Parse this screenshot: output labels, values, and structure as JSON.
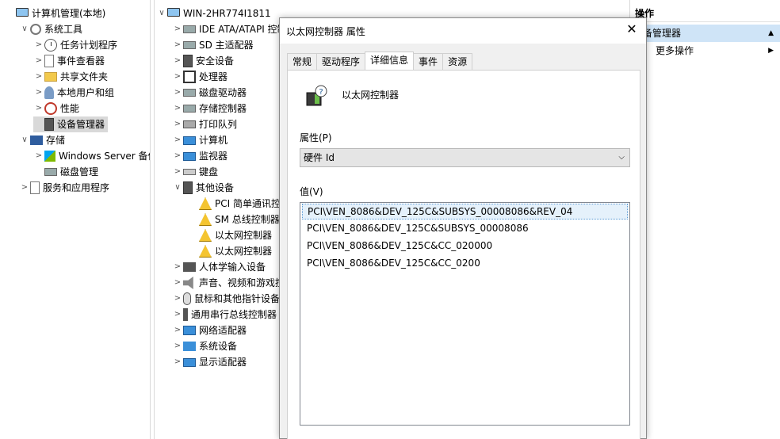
{
  "left_tree": {
    "items": [
      {
        "label": "计算机管理(本地)",
        "chev": "",
        "icon": "computer-management-icon",
        "indent": 0
      },
      {
        "label": "系统工具",
        "chev": "∨",
        "icon": "system-tools-icon",
        "indent": 1
      },
      {
        "label": "任务计划程序",
        "chev": ">",
        "icon": "task-scheduler-icon",
        "indent": 2
      },
      {
        "label": "事件查看器",
        "chev": ">",
        "icon": "event-viewer-icon",
        "indent": 2
      },
      {
        "label": "共享文件夹",
        "chev": ">",
        "icon": "shared-folders-icon",
        "indent": 2
      },
      {
        "label": "本地用户和组",
        "chev": ">",
        "icon": "local-users-icon",
        "indent": 2
      },
      {
        "label": "性能",
        "chev": ">",
        "icon": "performance-icon",
        "indent": 2
      },
      {
        "label": "设备管理器",
        "chev": "",
        "icon": "device-manager-icon",
        "indent": 2,
        "selected": true
      },
      {
        "label": "存储",
        "chev": "∨",
        "icon": "storage-icon",
        "indent": 1
      },
      {
        "label": "Windows Server 备份",
        "chev": ">",
        "icon": "windows-backup-icon",
        "indent": 2
      },
      {
        "label": "磁盘管理",
        "chev": "",
        "icon": "disk-management-icon",
        "indent": 2
      },
      {
        "label": "服务和应用程序",
        "chev": ">",
        "icon": "services-apps-icon",
        "indent": 1
      }
    ]
  },
  "device_tree": {
    "root": "WIN-2HR774I1811",
    "items": [
      {
        "label": "IDE ATA/ATAPI 控制器",
        "chev": ">",
        "icon": "ide-controller-icon",
        "indent": 1
      },
      {
        "label": "SD 主适配器",
        "chev": ">",
        "icon": "sd-host-adapter-icon",
        "indent": 1
      },
      {
        "label": "安全设备",
        "chev": ">",
        "icon": "security-device-icon",
        "indent": 1
      },
      {
        "label": "处理器",
        "chev": ">",
        "icon": "processor-icon",
        "indent": 1
      },
      {
        "label": "磁盘驱动器",
        "chev": ">",
        "icon": "disk-drive-icon",
        "indent": 1
      },
      {
        "label": "存储控制器",
        "chev": ">",
        "icon": "storage-controller-icon",
        "indent": 1
      },
      {
        "label": "打印队列",
        "chev": ">",
        "icon": "print-queue-icon",
        "indent": 1
      },
      {
        "label": "计算机",
        "chev": ">",
        "icon": "computer-icon",
        "indent": 1
      },
      {
        "label": "监视器",
        "chev": ">",
        "icon": "monitor-icon",
        "indent": 1
      },
      {
        "label": "键盘",
        "chev": ">",
        "icon": "keyboard-icon",
        "indent": 1
      },
      {
        "label": "其他设备",
        "chev": "∨",
        "icon": "other-devices-icon",
        "indent": 1
      },
      {
        "label": "PCI 简单通讯控制器",
        "chev": "",
        "icon": "warning-device-icon",
        "indent": 2
      },
      {
        "label": "SM 总线控制器",
        "chev": "",
        "icon": "warning-device-icon",
        "indent": 2
      },
      {
        "label": "以太网控制器",
        "chev": "",
        "icon": "warning-device-icon",
        "indent": 2
      },
      {
        "label": "以太网控制器",
        "chev": "",
        "icon": "warning-device-icon",
        "indent": 2
      },
      {
        "label": "人体学输入设备",
        "chev": ">",
        "icon": "hid-icon",
        "indent": 1
      },
      {
        "label": "声音、视频和游戏控制器",
        "chev": ">",
        "icon": "sound-icon",
        "indent": 1
      },
      {
        "label": "鼠标和其他指针设备",
        "chev": ">",
        "icon": "mouse-icon",
        "indent": 1
      },
      {
        "label": "通用串行总线控制器",
        "chev": ">",
        "icon": "usb-icon",
        "indent": 1
      },
      {
        "label": "网络适配器",
        "chev": ">",
        "icon": "network-adapter-icon",
        "indent": 1
      },
      {
        "label": "系统设备",
        "chev": ">",
        "icon": "system-devices-icon",
        "indent": 1
      },
      {
        "label": "显示适配器",
        "chev": ">",
        "icon": "display-adapter-icon",
        "indent": 1
      }
    ]
  },
  "actions": {
    "header": "操作",
    "section_title": "设备管理器",
    "more_actions": "更多操作"
  },
  "dialog": {
    "title": "以太网控制器 属性",
    "close_glyph": "✕",
    "tabs": [
      "常规",
      "驱动程序",
      "详细信息",
      "事件",
      "资源"
    ],
    "active_tab": 2,
    "device_name": "以太网控制器",
    "property_label": "属性(P)",
    "property_selected": "硬件 Id",
    "value_label": "值(V)",
    "values": [
      "PCI\\VEN_8086&DEV_125C&SUBSYS_00008086&REV_04",
      "PCI\\VEN_8086&DEV_125C&SUBSYS_00008086",
      "PCI\\VEN_8086&DEV_125C&CC_020000",
      "PCI\\VEN_8086&DEV_125C&CC_0200"
    ],
    "selected_value_index": 0
  },
  "colors": {
    "selection": "#d9d9d9",
    "action_title_bg": "#cfe4f7",
    "list_selection": "#e5f1fb"
  }
}
